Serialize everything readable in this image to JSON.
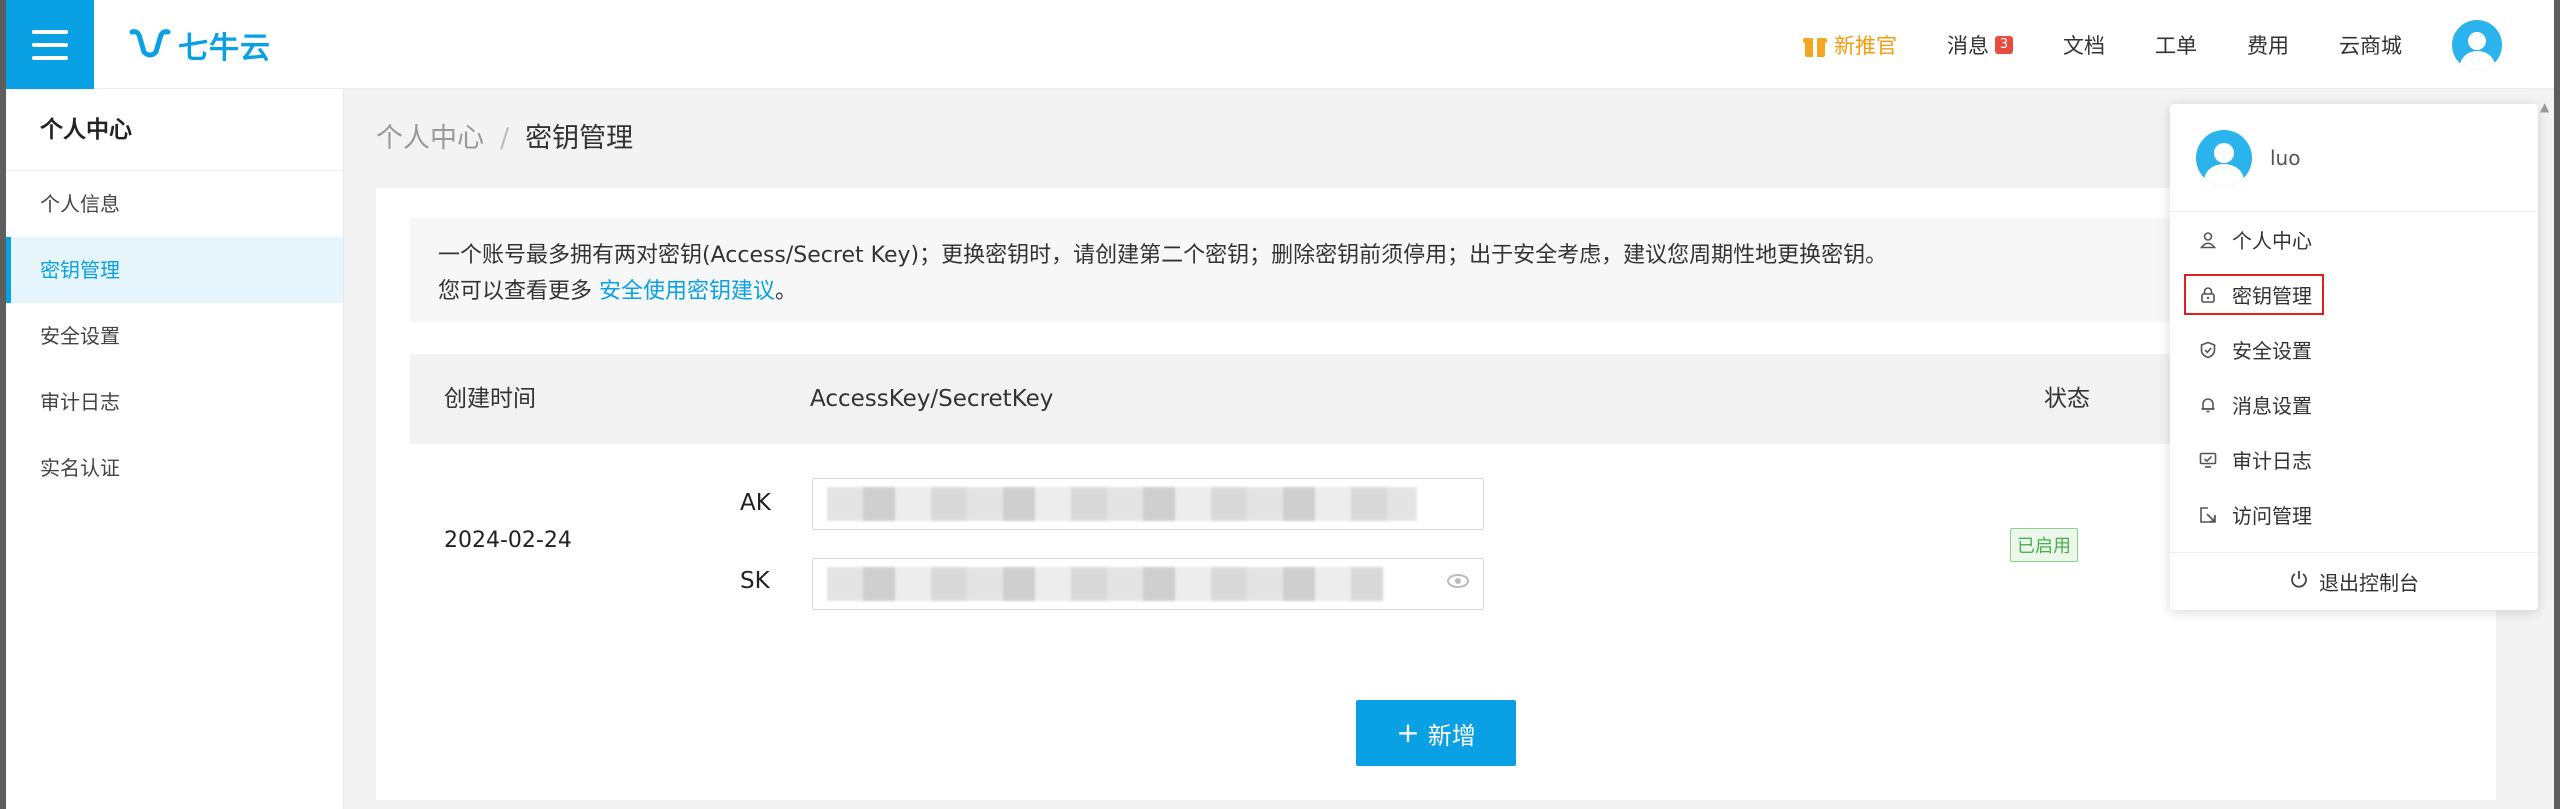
{
  "header": {
    "logo_text": "七牛云",
    "nav": [
      {
        "label": "新推官",
        "icon": "gift-icon",
        "highlight": true
      },
      {
        "label": "消息",
        "badge": "3"
      },
      {
        "label": "文档"
      },
      {
        "label": "工单"
      },
      {
        "label": "费用"
      },
      {
        "label": "云商城"
      }
    ]
  },
  "sidebar": {
    "title": "个人中心",
    "items": [
      {
        "label": "个人信息"
      },
      {
        "label": "密钥管理",
        "active": true
      },
      {
        "label": "安全设置"
      },
      {
        "label": "审计日志"
      },
      {
        "label": "实名认证"
      }
    ]
  },
  "breadcrumb": {
    "parent": "个人中心",
    "separator": "/",
    "current": "密钥管理"
  },
  "notice": {
    "line1": "一个账号最多拥有两对密钥(Access/Secret Key)；更换密钥时，请创建第二个密钥；删除密钥前须停用；出于安全考虑，建议您周期性地更换密钥。",
    "line2_prefix": "您可以查看更多",
    "line2_link": "安全使用密钥建议",
    "line2_suffix": "。"
  },
  "table": {
    "headers": [
      "创建时间",
      "AccessKey/SecretKey",
      "状态"
    ],
    "rows": [
      {
        "date": "2024-02-24",
        "ak_label": "AK",
        "sk_label": "SK",
        "status": "已启用"
      }
    ]
  },
  "add_button": {
    "label": "新增"
  },
  "dropdown": {
    "username": "luo",
    "items": [
      {
        "label": "个人中心",
        "icon": "user-icon"
      },
      {
        "label": "密钥管理",
        "icon": "lock-icon",
        "highlighted": true
      },
      {
        "label": "安全设置",
        "icon": "shield-icon"
      },
      {
        "label": "消息设置",
        "icon": "bell-icon"
      },
      {
        "label": "审计日志",
        "icon": "monitor-check-icon"
      },
      {
        "label": "访问管理",
        "icon": "access-icon"
      }
    ],
    "logout": "退出控制台"
  },
  "colors": {
    "brand": "#0aa1e4",
    "highlight": "#f39c12",
    "status_ok": "#4caf50",
    "badge": "#e74c3c",
    "focus_box": "#e02020"
  }
}
